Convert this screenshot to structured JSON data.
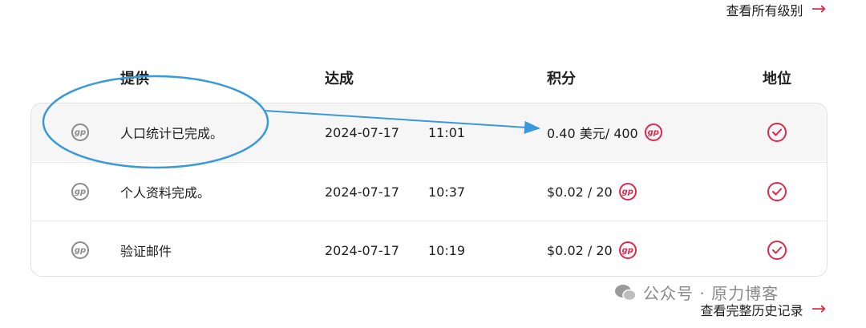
{
  "top_link": {
    "label": "查看所有级别"
  },
  "bottom_link": {
    "label": "查看完整历史记录"
  },
  "headers": {
    "offer": "提供",
    "achieved": "达成",
    "points": "积分",
    "status": "地位"
  },
  "rows": [
    {
      "offer": "人口统计已完成。",
      "date": "2024-07-17",
      "time": "11:01",
      "points": "0.40 美元/ 400"
    },
    {
      "offer": "个人资料完成。",
      "date": "2024-07-17",
      "time": "10:37",
      "points": "$0.02 / 20"
    },
    {
      "offer": "验证邮件",
      "date": "2024-07-17",
      "time": "10:19",
      "points": "$0.02 / 20"
    }
  ],
  "icons": {
    "gp_text": "gp",
    "points_icon": "gp-points-icon",
    "status_icon": "check-circle-icon"
  },
  "watermark": {
    "label": "公众号 · 原力博客"
  },
  "colors": {
    "accent": "#e0294a",
    "annotation": "#3a9ad9",
    "row_highlight": "#f6f6f6"
  }
}
